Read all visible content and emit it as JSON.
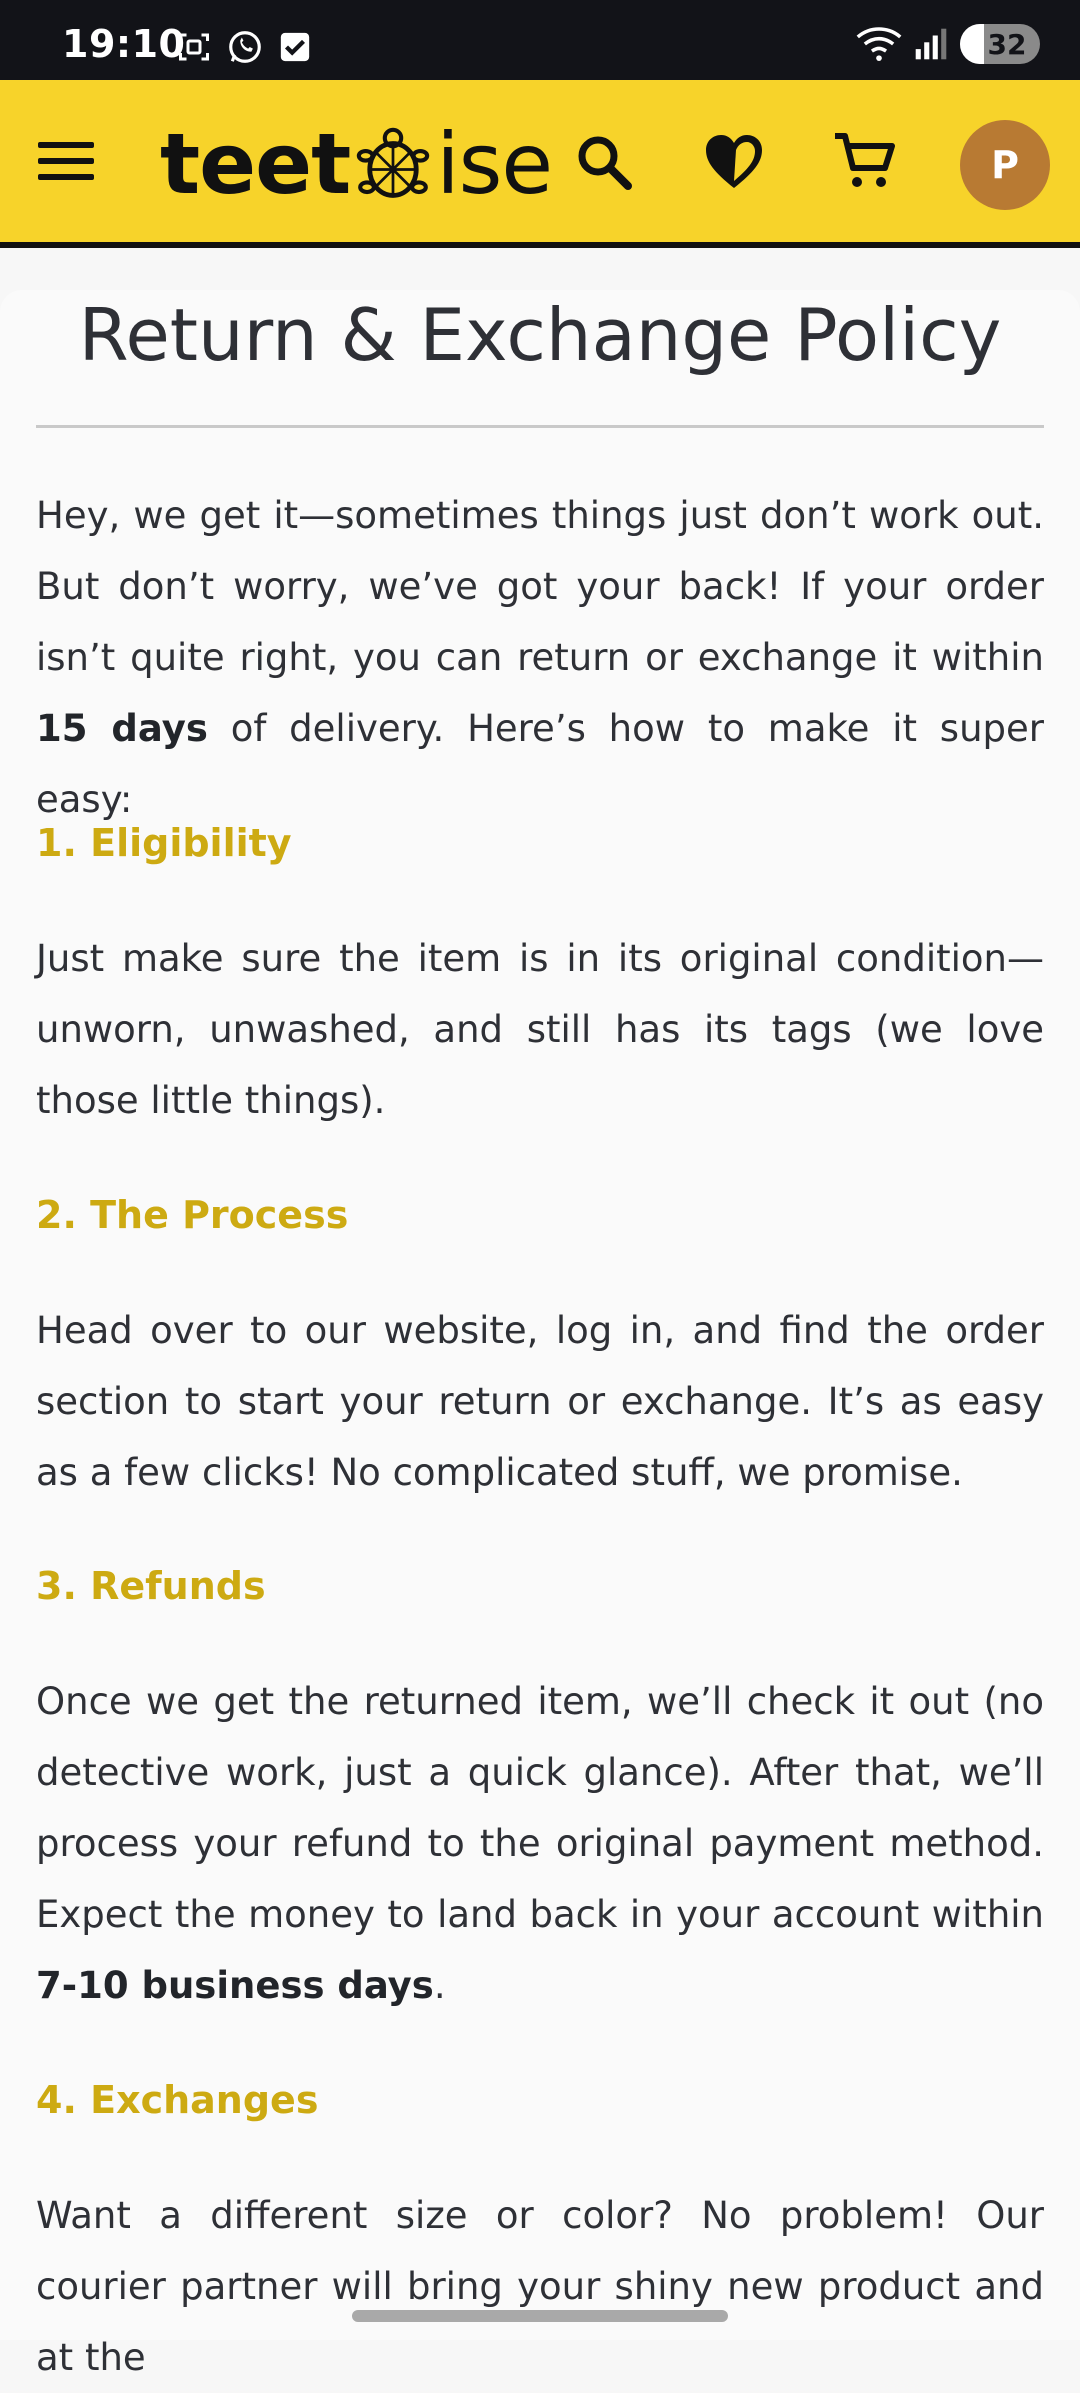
{
  "status_bar": {
    "time": "19:10",
    "battery": "32",
    "icons": [
      "screenshot-icon",
      "whatsapp-icon",
      "checkbox-icon",
      "wifi-icon",
      "signal-icon",
      "battery-icon"
    ]
  },
  "header": {
    "logo_part1": "teet",
    "logo_part2": "ise",
    "avatar_initial": "P",
    "colors": {
      "background": "#f7d32a",
      "avatar": "#b87a33"
    },
    "icons": [
      "menu-icon",
      "search-icon",
      "wishlist-heart-icon",
      "cart-icon"
    ]
  },
  "policy": {
    "title": "Return & Exchange Policy",
    "intro": {
      "text": "Hey, we get it—sometimes things just don’t work out. But don’t worry, we’ve got your back! If your order isn’t quite right, you can return or exchange it within ",
      "bold": "15 days",
      "after": " of delivery. Here’s how to make it super easy:"
    },
    "sections": [
      {
        "heading": "1. Eligibility",
        "text": "Just make sure the item is in its original condition—unworn, unwashed, and still has its tags (we love those little things)."
      },
      {
        "heading": "2. The Process",
        "text": "Head over to our website, log in, and find the order section to start your return or exchange. It’s as easy as a few clicks! No complicated stuff, we promise."
      },
      {
        "heading": "3. Refunds",
        "text": "Once we get the returned item, we’ll check it out (no detective work, just a quick glance). After that, we’ll process your refund to the original payment method. Expect the money to land back in your account within ",
        "bold": "7-10 business days",
        "after": "."
      },
      {
        "heading": "4. Exchanges",
        "text": "Want a different size or color? No problem! Our courier partner will bring your shiny new product and at the"
      }
    ],
    "accent_color": "#cdaa12"
  }
}
